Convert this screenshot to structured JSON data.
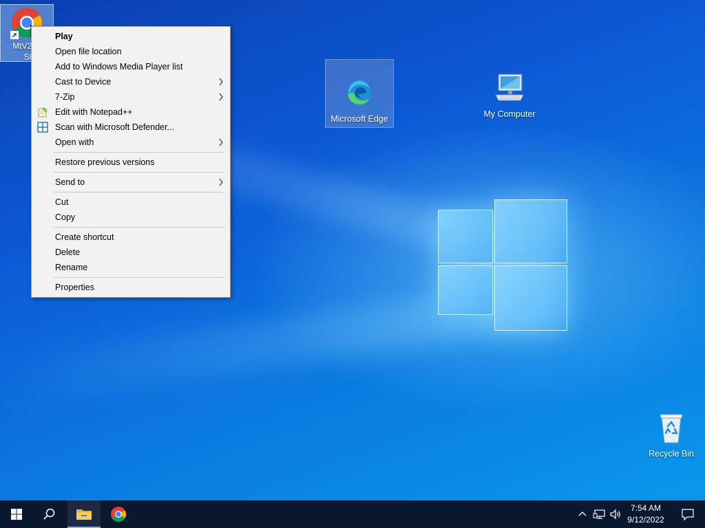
{
  "desktop": {
    "icons": {
      "chrome_shortcut": {
        "label_line1": "MtV2b_",
        "label_line2": "Short"
      },
      "edge": {
        "label": "Microsoft Edge"
      },
      "my_computer": {
        "label": "My Computer"
      },
      "recycle_bin": {
        "label": "Recycle Bin"
      }
    }
  },
  "context_menu": {
    "items": [
      {
        "label": "Play",
        "bold": true
      },
      {
        "label": "Open file location"
      },
      {
        "label": "Add to Windows Media Player list"
      },
      {
        "label": "Cast to Device",
        "submenu": true
      },
      {
        "label": "7-Zip",
        "submenu": true
      },
      {
        "label": "Edit with Notepad++",
        "icon": "notepad-plus-plus-icon"
      },
      {
        "label": "Scan with Microsoft Defender...",
        "icon": "defender-shield-icon"
      },
      {
        "label": "Open with",
        "submenu": true
      },
      {
        "label": "Restore previous versions"
      },
      {
        "label": "Send to",
        "submenu": true
      },
      {
        "label": "Cut"
      },
      {
        "label": "Copy"
      },
      {
        "label": "Create shortcut"
      },
      {
        "label": "Delete"
      },
      {
        "label": "Rename"
      },
      {
        "label": "Properties"
      }
    ]
  },
  "taskbar": {
    "pinned": [
      "start-icon",
      "search-icon",
      "file-explorer-icon",
      "chrome-icon"
    ],
    "tray": [
      "chevron-up-icon",
      "network-icon",
      "volume-icon"
    ],
    "clock": {
      "time": "7:54 AM",
      "date": "9/12/2022"
    }
  },
  "colors": {
    "desktop_blue": "#0d5ad6",
    "taskbar": "#0c1730",
    "menu_bg": "#f2f2f2"
  }
}
